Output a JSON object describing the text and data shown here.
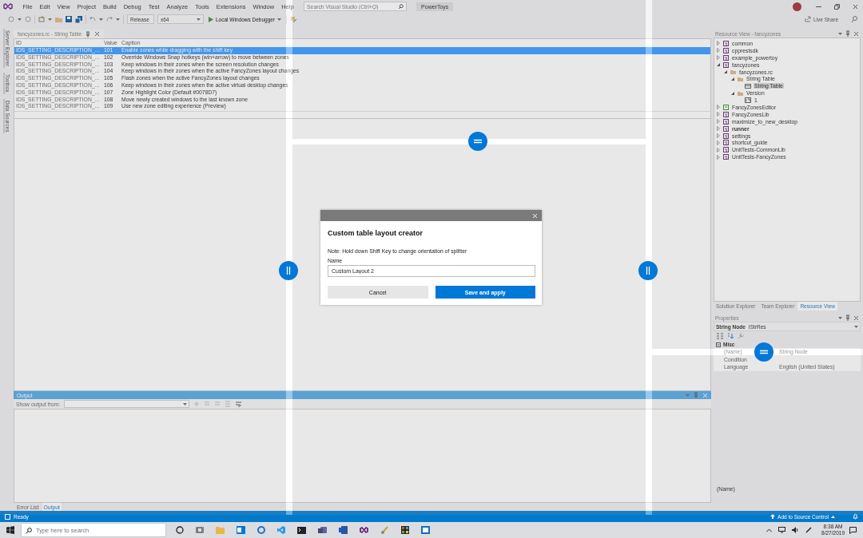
{
  "menu": [
    "File",
    "Edit",
    "View",
    "Project",
    "Build",
    "Debug",
    "Test",
    "Analyze",
    "Tools",
    "Extensions",
    "Window",
    "Help"
  ],
  "search": {
    "placeholder": "Search Visual Studio (Ctrl+Q)"
  },
  "solution": "PowerToys",
  "toolbar": {
    "configuration": "Release",
    "platform": "x64",
    "debugger": "Local Windows Debugger",
    "live_share": "Live Share"
  },
  "side_tabs": [
    "Server Explorer",
    "Toolbox",
    "Data Sources"
  ],
  "document": {
    "tab": "fancyzones.rc - String Table",
    "columns": [
      "ID",
      "Value",
      "Caption"
    ],
    "rows": [
      {
        "id": "IDS_SETTING_DESCRIPTION_...",
        "value": "101",
        "caption": "Enable zones while dragging with the shift key",
        "selected": true
      },
      {
        "id": "IDS_SETTING_DESCRIPTION_...",
        "value": "102",
        "caption": "Override Windows Snap hotkeys (win+arrow) to move between zones",
        "selected": false
      },
      {
        "id": "IDS_SETTING_DESCRIPTION_...",
        "value": "103",
        "caption": "Keep windows in their zones when the screen resolution changes",
        "selected": false
      },
      {
        "id": "IDS_SETTING_DESCRIPTION_...",
        "value": "104",
        "caption": "Keep windows in their zones when the active FancyZones layout changes",
        "selected": false
      },
      {
        "id": "IDS_SETTING_DESCRIPTION_...",
        "value": "105",
        "caption": "Flash zones when the active FancyZones layout changes",
        "selected": false
      },
      {
        "id": "IDS_SETTING_DESCRIPTION_...",
        "value": "106",
        "caption": "Keep windows in their zones when the active virtual desktop changes",
        "selected": false
      },
      {
        "id": "IDS_SETTING_DESCRIPTION_...",
        "value": "107",
        "caption": "Zone Highlight Color (Default #0078D7)",
        "selected": false
      },
      {
        "id": "IDS_SETTING_DESCRIPTION_...",
        "value": "108",
        "caption": "Move newly created windows to the last known zone",
        "selected": false
      },
      {
        "id": "IDS_SETTING_DESCRIPTION_...",
        "value": "109",
        "caption": "Use new zone editing experience (Preview)",
        "selected": false
      }
    ]
  },
  "resource_view": {
    "title": "Resource View - fancyzones",
    "tree": [
      {
        "label": "common",
        "kind": "project",
        "expanded": false,
        "bold": false,
        "selected": false
      },
      {
        "label": "cpprestsdk",
        "kind": "project",
        "expanded": false,
        "bold": false,
        "selected": false
      },
      {
        "label": "example_powertoy",
        "kind": "project",
        "expanded": false,
        "bold": false,
        "selected": false
      },
      {
        "label": "fancyzones",
        "kind": "project",
        "expanded": true,
        "bold": false,
        "selected": false,
        "children": [
          {
            "label": "fancyzones.rc",
            "kind": "folder",
            "expanded": true,
            "selected": false,
            "children": [
              {
                "label": "String Table",
                "kind": "folder",
                "expanded": true,
                "selected": false,
                "children": [
                  {
                    "label": "String Table",
                    "kind": "table",
                    "selected": true
                  }
                ]
              },
              {
                "label": "Version",
                "kind": "folder",
                "expanded": true,
                "selected": false,
                "children": [
                  {
                    "label": "1",
                    "kind": "version",
                    "selected": false
                  }
                ]
              }
            ]
          }
        ]
      },
      {
        "label": "FancyZonesEditor",
        "kind": "csproject",
        "expanded": false,
        "bold": false,
        "selected": false
      },
      {
        "label": "FancyZonesLib",
        "kind": "project",
        "expanded": false,
        "bold": false,
        "selected": false
      },
      {
        "label": "maximize_to_new_desktop",
        "kind": "project",
        "expanded": false,
        "bold": false,
        "selected": false
      },
      {
        "label": "runner",
        "kind": "project",
        "expanded": false,
        "bold": true,
        "selected": false
      },
      {
        "label": "settings",
        "kind": "project",
        "expanded": false,
        "bold": false,
        "selected": false
      },
      {
        "label": "shortcut_guide",
        "kind": "project",
        "expanded": false,
        "bold": false,
        "selected": false
      },
      {
        "label": "UnitTests-CommonLib",
        "kind": "project",
        "expanded": false,
        "bold": false,
        "selected": false
      },
      {
        "label": "UnitTests-FancyZones",
        "kind": "project",
        "expanded": false,
        "bold": false,
        "selected": false
      }
    ]
  },
  "panel_tabs": [
    {
      "label": "Solution Explorer",
      "selected": false
    },
    {
      "label": "Team Explorer",
      "selected": false
    },
    {
      "label": "Resource View",
      "selected": true
    }
  ],
  "properties": {
    "title": "Properties",
    "object": "String Node",
    "object_type": "IStrRes",
    "category": "Misc",
    "rows": [
      {
        "name": "(Name)",
        "value": "String Node"
      },
      {
        "name": "Condition"
      },
      {
        "name": "Language",
        "value": "English (United States)"
      }
    ],
    "description": "(Name)"
  },
  "output": {
    "title": "Output",
    "show_from": "Show output from:",
    "tabs": [
      {
        "label": "Error List",
        "selected": false
      },
      {
        "label": "Output",
        "selected": true
      }
    ]
  },
  "status_bar": {
    "status": "Ready",
    "source_control": "Add to Source Control"
  },
  "dialog": {
    "title": "Custom table layout creator",
    "note": "Note: Hold down Shift Key to change orientation of splitter",
    "name_label": "Name",
    "name_value": "Custom Layout 2",
    "buttons": [
      {
        "label": "Cancel",
        "kind": "secondary"
      },
      {
        "label": "Save and apply",
        "kind": "primary"
      }
    ]
  },
  "taskbar": {
    "search_placeholder": "Type here to search",
    "time": "8:38 AM",
    "date": "8/27/2019"
  }
}
